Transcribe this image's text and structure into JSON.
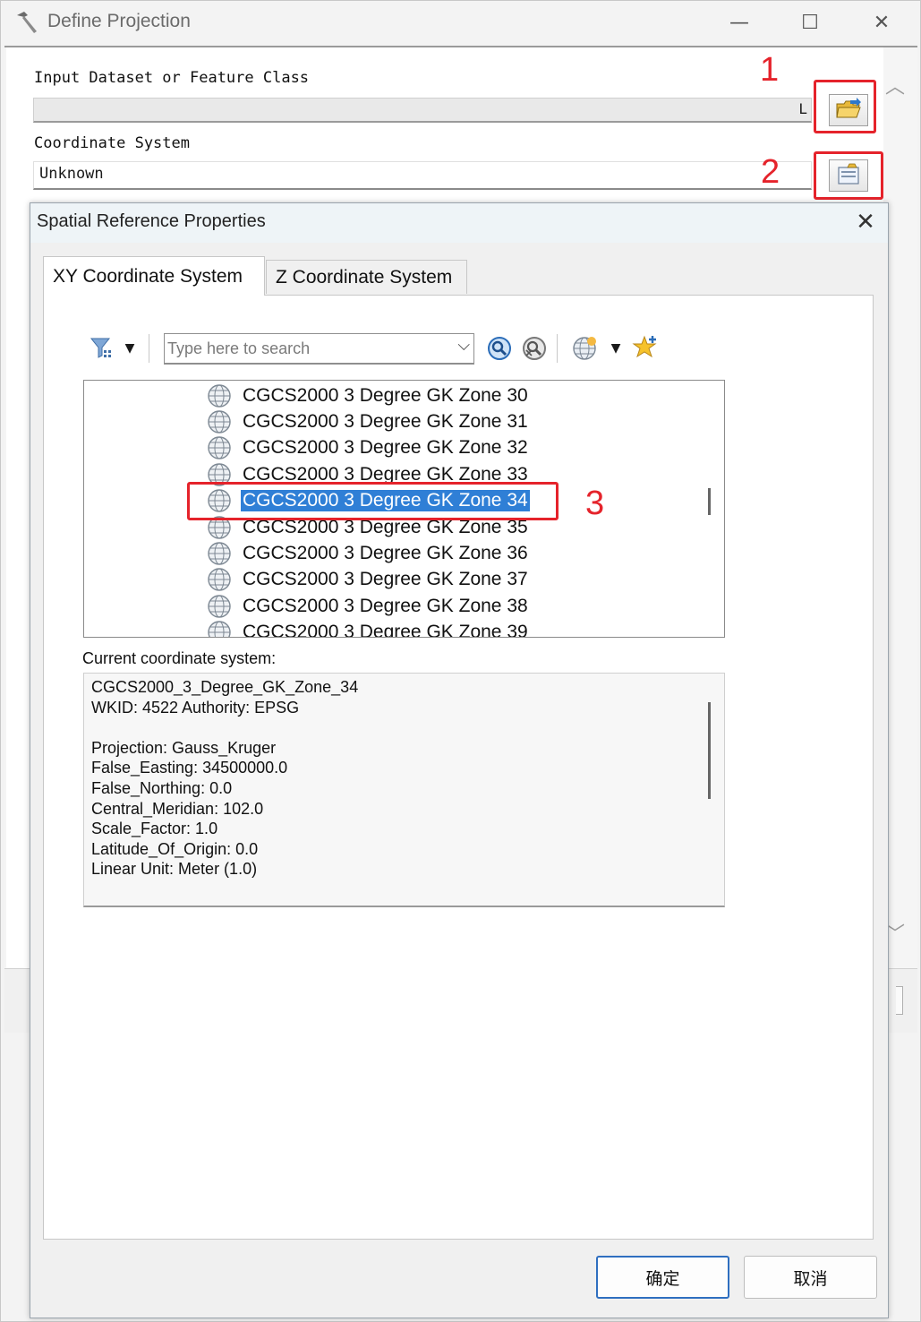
{
  "outer": {
    "title": "Define Projection",
    "min_glyph": "—",
    "max_glyph": "☐",
    "close_glyph": "✕",
    "input_label": "Input Dataset or Feature Class",
    "input_suffix": "L",
    "cs_label": "Coordinate System",
    "cs_value": "Unknown"
  },
  "annotations": {
    "n1": "1",
    "n2": "2",
    "n3": "3",
    "color": "#e5232b"
  },
  "dialog": {
    "title": "Spatial Reference Properties",
    "close_glyph": "✕",
    "tabs": [
      "XY Coordinate System",
      "Z Coordinate System"
    ],
    "search_placeholder": "Type here to search",
    "list": [
      "CGCS2000 3 Degree GK Zone 30",
      "CGCS2000 3 Degree GK Zone 31",
      "CGCS2000 3 Degree GK Zone 32",
      "CGCS2000 3 Degree GK Zone 33",
      "CGCS2000 3 Degree GK Zone 34",
      "CGCS2000 3 Degree GK Zone 35",
      "CGCS2000 3 Degree GK Zone 36",
      "CGCS2000 3 Degree GK Zone 37",
      "CGCS2000 3 Degree GK Zone 38",
      "CGCS2000 3 Degree GK Zone 39"
    ],
    "selected_index": 4,
    "current_label": "Current coordinate system:",
    "current_lines": [
      "CGCS2000_3_Degree_GK_Zone_34",
      "WKID: 4522 Authority: EPSG",
      "",
      "Projection: Gauss_Kruger",
      "False_Easting: 34500000.0",
      "False_Northing: 0.0",
      "Central_Meridian: 102.0",
      "Scale_Factor: 1.0",
      "Latitude_Of_Origin: 0.0",
      "Linear Unit: Meter (1.0)"
    ],
    "ok_label": "确定",
    "cancel_label": "取消",
    "selection_color": "#2f7fd6"
  }
}
